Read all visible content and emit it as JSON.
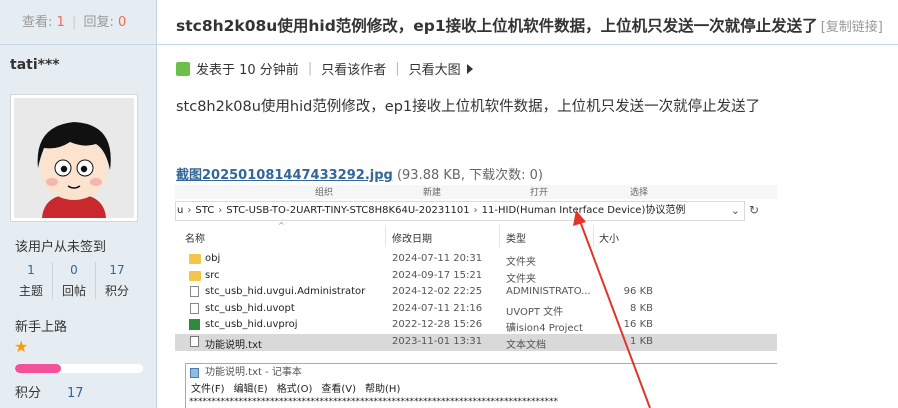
{
  "sidebar": {
    "stats": {
      "view_label": "查看:",
      "view_count": "1",
      "reply_label": "回复:",
      "reply_count": "0"
    },
    "author": "tati***",
    "signin_status": "该用户从未签到",
    "counts": [
      {
        "value": "1",
        "label": "主题"
      },
      {
        "value": "0",
        "label": "回帖"
      },
      {
        "value": "17",
        "label": "积分"
      }
    ],
    "rank": "新手上路",
    "rank_progress": 0.36,
    "points_label": "积分",
    "points_value": "17"
  },
  "post": {
    "title": "stc8h2k08u使用hid范例修改，ep1接收上位机软件数据，上位机只发送一次就停止发送了",
    "copy_link": "[复制链接]",
    "posted": "发表于 10 分钟前",
    "only_author": "只看该作者",
    "big_image": "只看大图",
    "body": "stc8h2k08u使用hid范例修改，ep1接收上位机软件数据，上位机只发送一次就停止发送了"
  },
  "attachment": {
    "filename": "截图202501081447433292.jpg",
    "info": "(93.88 KB, 下载次数: 0)"
  },
  "explorer": {
    "top_labels": [
      "组织",
      "新建",
      "打开",
      "选择"
    ],
    "path": [
      "u",
      "STC",
      "STC-USB-TO-2UART-TINY-STC8H8K64U-20231101",
      "11-HID(Human Interface Device)协议范例"
    ],
    "columns": [
      "名称",
      "修改日期",
      "类型",
      "大小"
    ],
    "files": [
      {
        "name": "obj",
        "date": "2024-07-11 20:31",
        "type": "文件夹",
        "size": "",
        "icon": "folder-icon"
      },
      {
        "name": "src",
        "date": "2024-09-17 15:21",
        "type": "文件夹",
        "size": "",
        "icon": "folder-icon"
      },
      {
        "name": "stc_usb_hid.uvgui.Administrator",
        "date": "2024-12-02 22:25",
        "type": "ADMINISTRATO...",
        "size": "96 KB",
        "icon": "file-icon"
      },
      {
        "name": "stc_usb_hid.uvopt",
        "date": "2024-07-11 21:16",
        "type": "UVOPT 文件",
        "size": "8 KB",
        "icon": "file-icon"
      },
      {
        "name": "stc_usb_hid.uvproj",
        "date": "2022-12-28 15:26",
        "type": "礦ision4 Project",
        "size": "16 KB",
        "icon": "project-icon"
      },
      {
        "name": "功能说明.txt",
        "date": "2023-11-01 13:31",
        "type": "文本文档",
        "size": "1 KB",
        "icon": "text-file-icon"
      }
    ]
  },
  "notepad": {
    "title": "功能说明.txt - 记事本",
    "menu": [
      "文件(F)",
      "编辑(E)",
      "格式(O)",
      "查看(V)",
      "帮助(H)"
    ],
    "first_line": "**********************************************************************************"
  },
  "colors": {
    "accent_link": "#336699",
    "count_red": "#f26c4f",
    "progress_pink": "#f3519a",
    "star": "#ff9a00",
    "arrow_red": "#e0362c"
  }
}
